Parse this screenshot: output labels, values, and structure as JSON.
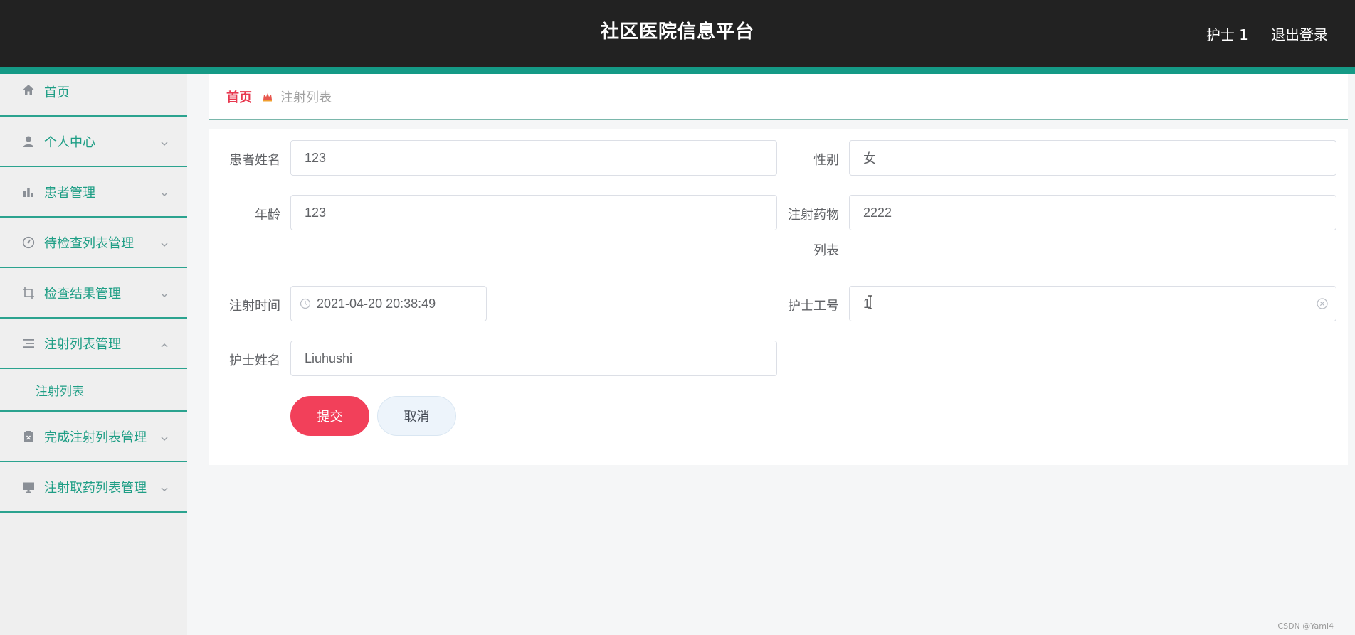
{
  "header": {
    "title": "社区医院信息平台",
    "user": "护士 1",
    "logout": "退出登录"
  },
  "sidebar": {
    "items": [
      {
        "label": "首页",
        "icon": "home-icon"
      },
      {
        "label": "个人中心",
        "icon": "user-icon",
        "expanded": false
      },
      {
        "label": "患者管理",
        "icon": "bar-chart-icon",
        "expanded": false
      },
      {
        "label": "待检查列表管理",
        "icon": "gauge-icon",
        "expanded": false
      },
      {
        "label": "检查结果管理",
        "icon": "crop-icon",
        "expanded": false
      },
      {
        "label": "注射列表管理",
        "icon": "list-icon",
        "expanded": true
      },
      {
        "label": "完成注射列表管理",
        "icon": "clipboard-icon",
        "expanded": false
      },
      {
        "label": "注射取药列表管理",
        "icon": "monitor-icon",
        "expanded": false
      }
    ],
    "submenu": {
      "label": "注射列表"
    }
  },
  "breadcrumb": {
    "home": "首页",
    "current": "注射列表"
  },
  "form": {
    "patient_name": {
      "label": "患者姓名",
      "value": "123"
    },
    "gender": {
      "label": "性别",
      "value": "女"
    },
    "age": {
      "label": "年龄",
      "value": "123"
    },
    "drug_list": {
      "label_line1": "注射药物",
      "label_line2": "列表",
      "value": "2222"
    },
    "injection_time": {
      "label": "注射时间",
      "value": "2021-04-20 20:38:49"
    },
    "nurse_id": {
      "label": "护士工号",
      "value": "1"
    },
    "nurse_name": {
      "label": "护士姓名",
      "value": "Liuhushi"
    },
    "submit": "提交",
    "cancel": "取消"
  },
  "watermark": "CSDN @Yaml4",
  "colors": {
    "header_bg": "#222222",
    "accent": "#159a86",
    "menu_text": "#1e9e85",
    "breadcrumb_home": "#e8384f",
    "submit_bg": "#f2405a"
  }
}
